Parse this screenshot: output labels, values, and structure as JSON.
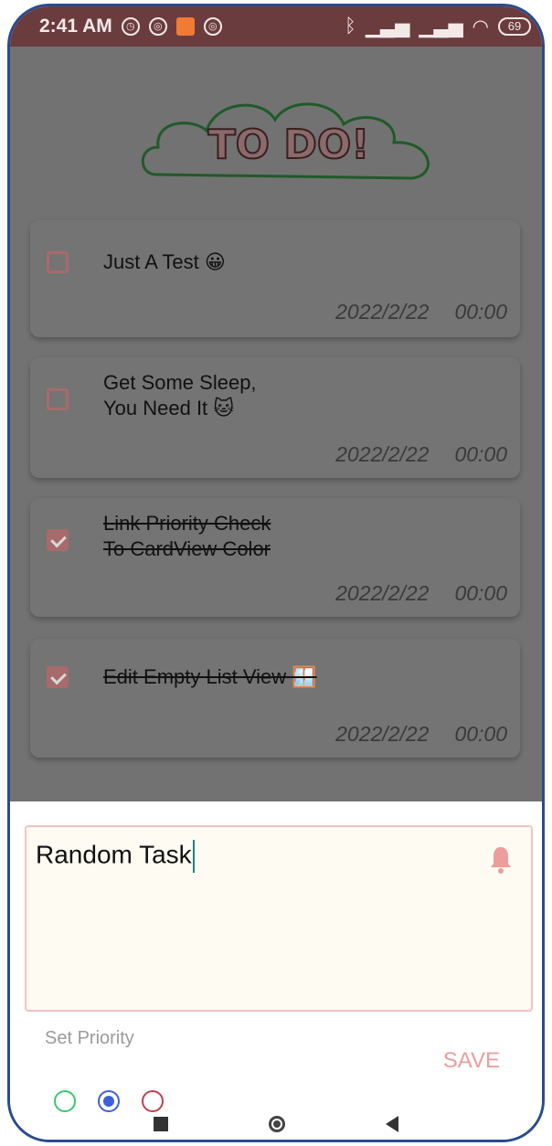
{
  "status_bar": {
    "time": "2:41 AM",
    "battery": "69"
  },
  "header": {
    "logo_text": "TO DO!"
  },
  "tasks": [
    {
      "text": "Just A Test 😀",
      "date": "2022/2/22",
      "time": "00:00",
      "checked": false
    },
    {
      "text_line1": "Get Some Sleep,",
      "text_line2": "You Need It 🐱",
      "date": "2022/2/22",
      "time": "00:00",
      "checked": false
    },
    {
      "text_line1": "Link Priority Check",
      "text_line2": "To CardView Color",
      "date": "2022/2/22",
      "time": "00:00",
      "checked": true
    },
    {
      "text": "Edit Empty List View 🪟",
      "date": "2022/2/22",
      "time": "00:00",
      "checked": true
    }
  ],
  "bottom_sheet": {
    "input_value": "Random Task",
    "priority_label": "Set Priority",
    "save_label": "SAVE",
    "priority_options": [
      "green",
      "blue",
      "red"
    ],
    "selected_priority": "blue"
  },
  "colors": {
    "status_bar": "#6b3c3d",
    "overlay": "#727272",
    "accent_pink": "#ee9d9d",
    "priority_green": "#3bc66e",
    "priority_blue": "#3f5fd6",
    "priority_red": "#c0404f"
  }
}
